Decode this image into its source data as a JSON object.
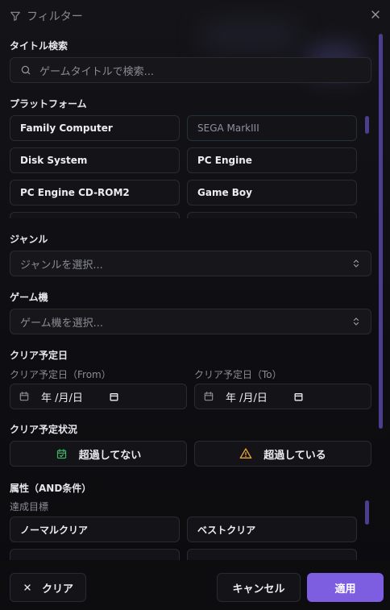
{
  "header": {
    "title": "フィルター"
  },
  "title_search": {
    "label": "タイトル検索",
    "placeholder": "ゲームタイトルで検索..."
  },
  "platform": {
    "label": "プラットフォーム",
    "items": [
      "Family Computer",
      "SEGA MarkIII",
      "Disk System",
      "PC Engine",
      "PC Engine CD-ROM2",
      "Game Boy"
    ]
  },
  "genre": {
    "label": "ジャンル",
    "placeholder": "ジャンルを選択..."
  },
  "console": {
    "label": "ゲーム機",
    "placeholder": "ゲーム機を選択..."
  },
  "clear_date": {
    "label": "クリア予定日",
    "from_label": "クリア予定日（From）",
    "to_label": "クリア予定日（To）",
    "date_placeholder": "年 /月/日"
  },
  "clear_status": {
    "label": "クリア予定状況",
    "not_overdue": "超過してない",
    "overdue": "超過している"
  },
  "attributes": {
    "label": "属性（AND条件）",
    "sub_label": "達成目標",
    "items": [
      "ノーマルクリア",
      "ベストクリア"
    ]
  },
  "footer": {
    "clear": "クリア",
    "cancel": "キャンセル",
    "apply": "適用"
  },
  "colors": {
    "accent": "#7d5ee0",
    "success": "#3cb364",
    "warning": "#e8a23a"
  }
}
